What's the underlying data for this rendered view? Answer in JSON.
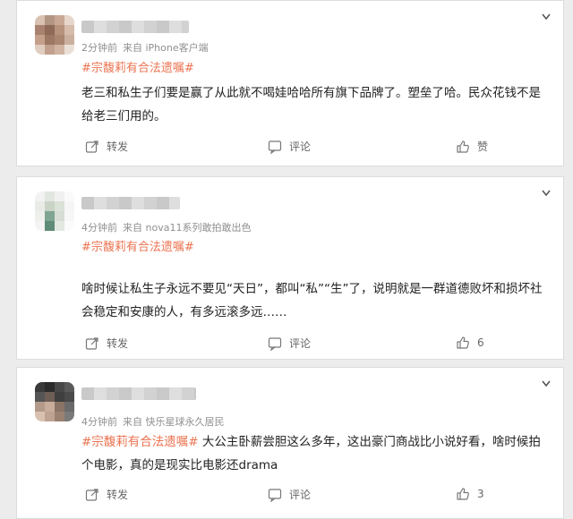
{
  "comments": [
    {
      "time": "2分钟前",
      "source": "来自 iPhone客户端",
      "tag": "#宗馥莉有合法遗嘱#",
      "text": "老三和私生子们要是赢了从此就不喝娃哈哈所有旗下品牌了。塑垒了哈。民众花钱不是给老三们用的。",
      "repost": "转发",
      "comment": "评论",
      "like": "赞"
    },
    {
      "time": "4分钟前",
      "source": "来自 nova11系列敢拍敢出色",
      "tag": "#宗馥莉有合法遗嘱#",
      "text": "啥时候让私生子永远不要见“天日”，都叫“私”“生”了，说明就是一群道德败坏和损坏社会稳定和安康的人，有多远滚多远……",
      "repost": "转发",
      "comment": "评论",
      "like": "6"
    },
    {
      "time": "4分钟前",
      "source": "来自 快乐星球永久居民",
      "tag": "#宗馥莉有合法遗嘱#",
      "text": "大公主卧薪尝胆这么多年，这出豪门商战比小说好看，啥时候拍个电影，真的是现实比电影还drama",
      "repost": "转发",
      "comment": "评论",
      "like": "3"
    }
  ],
  "icons": {
    "repost": "repost-icon",
    "comment": "comment-icon",
    "like": "thumbs-up-icon",
    "menu": "chevron-down-icon"
  },
  "colors": {
    "tag": "#eb7350",
    "meta": "#8f8f8f",
    "background": "#ececec"
  }
}
